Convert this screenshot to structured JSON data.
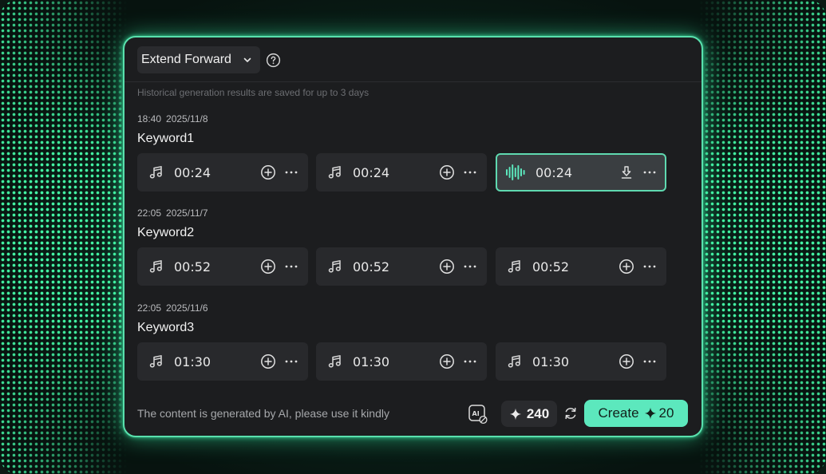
{
  "header": {
    "mode_label": "Extend Forward",
    "icons": {
      "chevron": "chevron-down-icon",
      "help": "help-circle-icon"
    }
  },
  "note": "Historical generation results are saved for up to 3 days",
  "groups": [
    {
      "time": "18:40",
      "date": "2025/11/8",
      "title": "Keyword1",
      "tracks": [
        {
          "duration": "00:24",
          "state": "idle"
        },
        {
          "duration": "00:24",
          "state": "idle"
        },
        {
          "duration": "00:24",
          "state": "playing"
        }
      ]
    },
    {
      "time": "22:05",
      "date": "2025/11/7",
      "title": "Keyword2",
      "tracks": [
        {
          "duration": "00:52",
          "state": "idle"
        },
        {
          "duration": "00:52",
          "state": "idle"
        },
        {
          "duration": "00:52",
          "state": "idle"
        }
      ]
    },
    {
      "time": "22:05",
      "date": "2025/11/6",
      "title": "Keyword3",
      "tracks": [
        {
          "duration": "01:30",
          "state": "idle"
        },
        {
          "duration": "01:30",
          "state": "idle"
        },
        {
          "duration": "01:30",
          "state": "idle"
        }
      ]
    }
  ],
  "footer": {
    "disclaimer": "The content is generated by AI, please use it kindly",
    "credits": "240",
    "create_label": "Create",
    "create_cost": "20"
  },
  "colors": {
    "accent": "#5ce8bd",
    "panel": "#1c1d1f",
    "card": "#28292c",
    "glow": "#46ffaa"
  }
}
